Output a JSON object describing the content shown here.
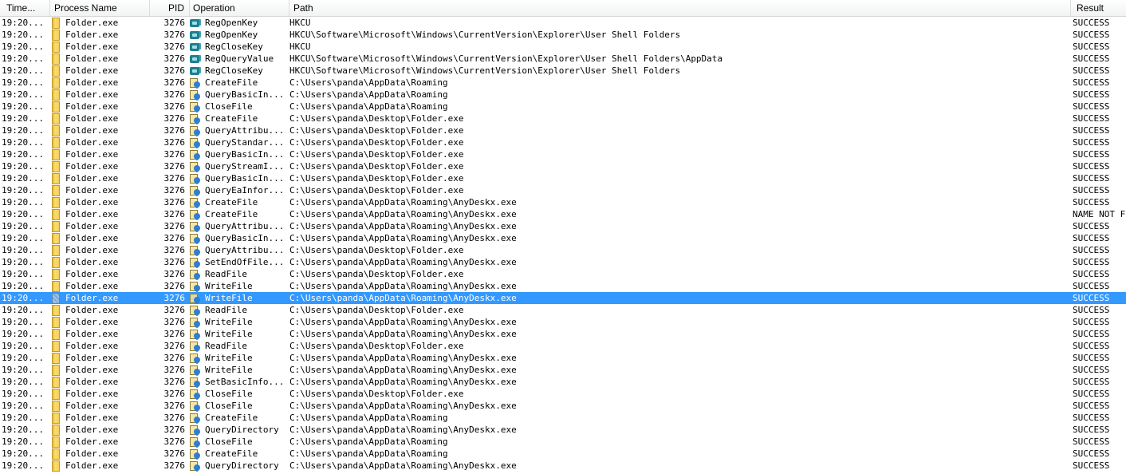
{
  "columns": {
    "time": "Time...",
    "process": "Process Name",
    "pid": "PID",
    "operation": "Operation",
    "path": "Path",
    "result": "Result"
  },
  "icons": {
    "process": "folder-icon",
    "registry": "registry-icon",
    "file": "file-system-icon"
  },
  "selection_color": "#3399ff",
  "rows": [
    {
      "time": "19:20...",
      "process": "Folder.exe",
      "pid": "3276",
      "type": "reg",
      "operation": "RegOpenKey",
      "path": "HKCU",
      "result": "SUCCESS"
    },
    {
      "time": "19:20...",
      "process": "Folder.exe",
      "pid": "3276",
      "type": "reg",
      "operation": "RegOpenKey",
      "path": "HKCU\\Software\\Microsoft\\Windows\\CurrentVersion\\Explorer\\User Shell Folders",
      "result": "SUCCESS"
    },
    {
      "time": "19:20...",
      "process": "Folder.exe",
      "pid": "3276",
      "type": "reg",
      "operation": "RegCloseKey",
      "path": "HKCU",
      "result": "SUCCESS"
    },
    {
      "time": "19:20...",
      "process": "Folder.exe",
      "pid": "3276",
      "type": "reg",
      "operation": "RegQueryValue",
      "path": "HKCU\\Software\\Microsoft\\Windows\\CurrentVersion\\Explorer\\User Shell Folders\\AppData",
      "result": "SUCCESS"
    },
    {
      "time": "19:20...",
      "process": "Folder.exe",
      "pid": "3276",
      "type": "reg",
      "operation": "RegCloseKey",
      "path": "HKCU\\Software\\Microsoft\\Windows\\CurrentVersion\\Explorer\\User Shell Folders",
      "result": "SUCCESS"
    },
    {
      "time": "19:20...",
      "process": "Folder.exe",
      "pid": "3276",
      "type": "file",
      "operation": "CreateFile",
      "path": "C:\\Users\\panda\\AppData\\Roaming",
      "result": "SUCCESS"
    },
    {
      "time": "19:20...",
      "process": "Folder.exe",
      "pid": "3276",
      "type": "file",
      "operation": "QueryBasicIn...",
      "path": "C:\\Users\\panda\\AppData\\Roaming",
      "result": "SUCCESS"
    },
    {
      "time": "19:20...",
      "process": "Folder.exe",
      "pid": "3276",
      "type": "file",
      "operation": "CloseFile",
      "path": "C:\\Users\\panda\\AppData\\Roaming",
      "result": "SUCCESS"
    },
    {
      "time": "19:20...",
      "process": "Folder.exe",
      "pid": "3276",
      "type": "file",
      "operation": "CreateFile",
      "path": "C:\\Users\\panda\\Desktop\\Folder.exe",
      "result": "SUCCESS"
    },
    {
      "time": "19:20...",
      "process": "Folder.exe",
      "pid": "3276",
      "type": "file",
      "operation": "QueryAttribu...",
      "path": "C:\\Users\\panda\\Desktop\\Folder.exe",
      "result": "SUCCESS"
    },
    {
      "time": "19:20...",
      "process": "Folder.exe",
      "pid": "3276",
      "type": "file",
      "operation": "QueryStandar...",
      "path": "C:\\Users\\panda\\Desktop\\Folder.exe",
      "result": "SUCCESS"
    },
    {
      "time": "19:20...",
      "process": "Folder.exe",
      "pid": "3276",
      "type": "file",
      "operation": "QueryBasicIn...",
      "path": "C:\\Users\\panda\\Desktop\\Folder.exe",
      "result": "SUCCESS"
    },
    {
      "time": "19:20...",
      "process": "Folder.exe",
      "pid": "3276",
      "type": "file",
      "operation": "QueryStreamI...",
      "path": "C:\\Users\\panda\\Desktop\\Folder.exe",
      "result": "SUCCESS"
    },
    {
      "time": "19:20...",
      "process": "Folder.exe",
      "pid": "3276",
      "type": "file",
      "operation": "QueryBasicIn...",
      "path": "C:\\Users\\panda\\Desktop\\Folder.exe",
      "result": "SUCCESS"
    },
    {
      "time": "19:20...",
      "process": "Folder.exe",
      "pid": "3276",
      "type": "file",
      "operation": "QueryEaInfor...",
      "path": "C:\\Users\\panda\\Desktop\\Folder.exe",
      "result": "SUCCESS"
    },
    {
      "time": "19:20...",
      "process": "Folder.exe",
      "pid": "3276",
      "type": "file",
      "operation": "CreateFile",
      "path": "C:\\Users\\panda\\AppData\\Roaming\\AnyDeskx.exe",
      "result": "SUCCESS"
    },
    {
      "time": "19:20...",
      "process": "Folder.exe",
      "pid": "3276",
      "type": "file",
      "operation": "CreateFile",
      "path": "C:\\Users\\panda\\AppData\\Roaming\\AnyDeskx.exe",
      "result": "NAME NOT F"
    },
    {
      "time": "19:20...",
      "process": "Folder.exe",
      "pid": "3276",
      "type": "file",
      "operation": "QueryAttribu...",
      "path": "C:\\Users\\panda\\AppData\\Roaming\\AnyDeskx.exe",
      "result": "SUCCESS"
    },
    {
      "time": "19:20...",
      "process": "Folder.exe",
      "pid": "3276",
      "type": "file",
      "operation": "QueryBasicIn...",
      "path": "C:\\Users\\panda\\AppData\\Roaming\\AnyDeskx.exe",
      "result": "SUCCESS"
    },
    {
      "time": "19:20...",
      "process": "Folder.exe",
      "pid": "3276",
      "type": "file",
      "operation": "QueryAttribu...",
      "path": "C:\\Users\\panda\\Desktop\\Folder.exe",
      "result": "SUCCESS"
    },
    {
      "time": "19:20...",
      "process": "Folder.exe",
      "pid": "3276",
      "type": "file",
      "operation": "SetEndOfFile...",
      "path": "C:\\Users\\panda\\AppData\\Roaming\\AnyDeskx.exe",
      "result": "SUCCESS"
    },
    {
      "time": "19:20...",
      "process": "Folder.exe",
      "pid": "3276",
      "type": "file",
      "operation": "ReadFile",
      "path": "C:\\Users\\panda\\Desktop\\Folder.exe",
      "result": "SUCCESS"
    },
    {
      "time": "19:20...",
      "process": "Folder.exe",
      "pid": "3276",
      "type": "file",
      "operation": "WriteFile",
      "path": "C:\\Users\\panda\\AppData\\Roaming\\AnyDeskx.exe",
      "result": "SUCCESS"
    },
    {
      "time": "19:20...",
      "process": "Folder.exe",
      "pid": "3276",
      "type": "file",
      "operation": "WriteFile",
      "path": "C:\\Users\\panda\\AppData\\Roaming\\AnyDeskx.exe",
      "result": "SUCCESS",
      "selected": true
    },
    {
      "time": "19:20...",
      "process": "Folder.exe",
      "pid": "3276",
      "type": "file",
      "operation": "ReadFile",
      "path": "C:\\Users\\panda\\Desktop\\Folder.exe",
      "result": "SUCCESS"
    },
    {
      "time": "19:20...",
      "process": "Folder.exe",
      "pid": "3276",
      "type": "file",
      "operation": "WriteFile",
      "path": "C:\\Users\\panda\\AppData\\Roaming\\AnyDeskx.exe",
      "result": "SUCCESS"
    },
    {
      "time": "19:20...",
      "process": "Folder.exe",
      "pid": "3276",
      "type": "file",
      "operation": "WriteFile",
      "path": "C:\\Users\\panda\\AppData\\Roaming\\AnyDeskx.exe",
      "result": "SUCCESS"
    },
    {
      "time": "19:20...",
      "process": "Folder.exe",
      "pid": "3276",
      "type": "file",
      "operation": "ReadFile",
      "path": "C:\\Users\\panda\\Desktop\\Folder.exe",
      "result": "SUCCESS"
    },
    {
      "time": "19:20...",
      "process": "Folder.exe",
      "pid": "3276",
      "type": "file",
      "operation": "WriteFile",
      "path": "C:\\Users\\panda\\AppData\\Roaming\\AnyDeskx.exe",
      "result": "SUCCESS"
    },
    {
      "time": "19:20...",
      "process": "Folder.exe",
      "pid": "3276",
      "type": "file",
      "operation": "WriteFile",
      "path": "C:\\Users\\panda\\AppData\\Roaming\\AnyDeskx.exe",
      "result": "SUCCESS"
    },
    {
      "time": "19:20...",
      "process": "Folder.exe",
      "pid": "3276",
      "type": "file",
      "operation": "SetBasicInfo...",
      "path": "C:\\Users\\panda\\AppData\\Roaming\\AnyDeskx.exe",
      "result": "SUCCESS"
    },
    {
      "time": "19:20...",
      "process": "Folder.exe",
      "pid": "3276",
      "type": "file",
      "operation": "CloseFile",
      "path": "C:\\Users\\panda\\Desktop\\Folder.exe",
      "result": "SUCCESS"
    },
    {
      "time": "19:20...",
      "process": "Folder.exe",
      "pid": "3276",
      "type": "file",
      "operation": "CloseFile",
      "path": "C:\\Users\\panda\\AppData\\Roaming\\AnyDeskx.exe",
      "result": "SUCCESS"
    },
    {
      "time": "19:20...",
      "process": "Folder.exe",
      "pid": "3276",
      "type": "file",
      "operation": "CreateFile",
      "path": "C:\\Users\\panda\\AppData\\Roaming",
      "result": "SUCCESS"
    },
    {
      "time": "19:20...",
      "process": "Folder.exe",
      "pid": "3276",
      "type": "file",
      "operation": "QueryDirectory",
      "path": "C:\\Users\\panda\\AppData\\Roaming\\AnyDeskx.exe",
      "result": "SUCCESS"
    },
    {
      "time": "19:20...",
      "process": "Folder.exe",
      "pid": "3276",
      "type": "file",
      "operation": "CloseFile",
      "path": "C:\\Users\\panda\\AppData\\Roaming",
      "result": "SUCCESS"
    },
    {
      "time": "19:20...",
      "process": "Folder.exe",
      "pid": "3276",
      "type": "file",
      "operation": "CreateFile",
      "path": "C:\\Users\\panda\\AppData\\Roaming",
      "result": "SUCCESS"
    },
    {
      "time": "19:20...",
      "process": "Folder.exe",
      "pid": "3276",
      "type": "file",
      "operation": "QueryDirectory",
      "path": "C:\\Users\\panda\\AppData\\Roaming\\AnyDeskx.exe",
      "result": "SUCCESS"
    }
  ]
}
